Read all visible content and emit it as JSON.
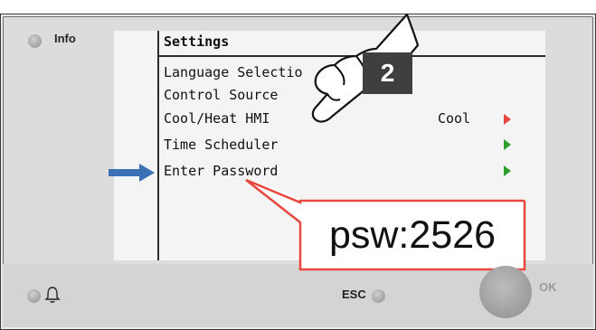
{
  "info_button": {
    "label": "Info"
  },
  "lcd": {
    "title": "Settings",
    "items": [
      {
        "label": "Language Selectio",
        "value": ""
      },
      {
        "label": "Control Source",
        "value": ""
      },
      {
        "label": "Cool/Heat HMI",
        "value": "Cool"
      },
      {
        "label": "Time Scheduler",
        "value": ""
      },
      {
        "label": "Enter Password",
        "value": ""
      }
    ]
  },
  "step_badge": {
    "number": "2"
  },
  "callout": {
    "text": "psw:2526"
  },
  "controls": {
    "esc_label": "ESC",
    "ok_label": "OK"
  },
  "icons": {
    "selection_arrow": "right-arrow-icon",
    "submenu_arrow": "play-triangle-icon",
    "bell": "bell-icon",
    "pointer": "pointing-hand-icon"
  },
  "colors": {
    "selection_arrow": "#3b6fb6",
    "submenu_arrow": "#2aa02a",
    "active_arrow": "#e8473d",
    "callout_border": "#e8473d",
    "badge_bg": "#3f3f3f"
  }
}
